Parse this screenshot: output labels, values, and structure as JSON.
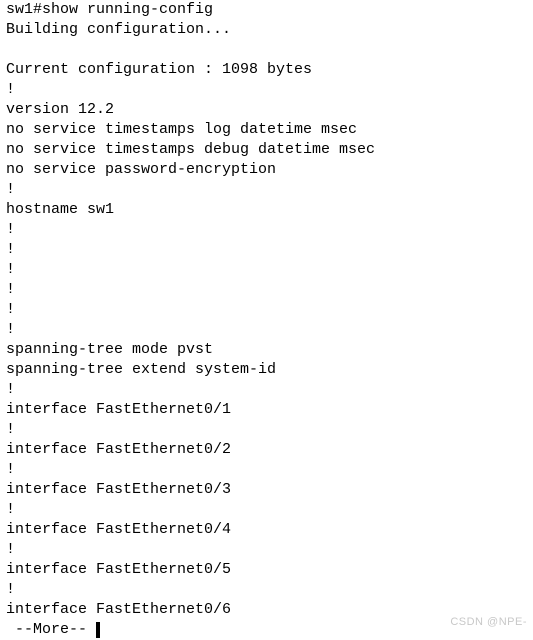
{
  "terminal": {
    "prompt_line": "sw1#show running-config",
    "lines": [
      "sw1#show running-config",
      "Building configuration...",
      "",
      "Current configuration : 1098 bytes",
      "!",
      "version 12.2",
      "no service timestamps log datetime msec",
      "no service timestamps debug datetime msec",
      "no service password-encryption",
      "!",
      "hostname sw1",
      "!",
      "!",
      "!",
      "!",
      "!",
      "!",
      "spanning-tree mode pvst",
      "spanning-tree extend system-id",
      "!",
      "interface FastEthernet0/1",
      "!",
      "interface FastEthernet0/2",
      "!",
      "interface FastEthernet0/3",
      "!",
      "interface FastEthernet0/4",
      "!",
      "interface FastEthernet0/5",
      "!",
      "interface FastEthernet0/6"
    ],
    "pager_label": " --More--",
    "text_color": "#000000",
    "background_color": "#ffffff"
  },
  "watermark": {
    "text": "CSDN @NPE-",
    "color": "#c8c8c8"
  }
}
